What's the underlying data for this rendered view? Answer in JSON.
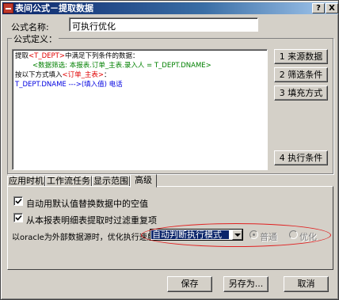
{
  "window": {
    "title": "表间公式－提取数据",
    "help_label": "?",
    "close_label": "X"
  },
  "formula_name": {
    "label": "公式名称:",
    "value": "可执行优化"
  },
  "definition": {
    "legend": "公式定义：",
    "lines": [
      {
        "pre": "提取",
        "kw": "<T_DEPT>",
        "post": "中满足下列条件的数据："
      },
      {
        "text": "<数据筛选: 本报表.订单_主表.录入人 = T_DEPT.DNAME>"
      },
      {
        "pre": "按以下方式填入",
        "kw": "<订单_主表>",
        "post": "："
      },
      {
        "pre": "T_DEPT.DNAME  --->",
        "kw": "(填入值)",
        "post": "  电话"
      }
    ]
  },
  "side_buttons": {
    "source_data": "1 来源数据",
    "filter_condition": "2 筛选条件",
    "fill_method": "3 填充方式",
    "exec_condition": "4 执行条件"
  },
  "tabs": [
    "应用时机",
    "工作流任务",
    "显示范围",
    "高级"
  ],
  "advanced": {
    "option1": "自动用默认值替换数据中的空值",
    "option2": "从本报表明细表提取时过滤重复项",
    "speed_label": "以oracle为外部数据源时，优化执行速度:",
    "mode_value": "自动判断执行模式",
    "radio_normal": "普通",
    "radio_optimize": "优化"
  },
  "footer": {
    "save": "保存",
    "save_as": "另存为...",
    "cancel": "取消"
  }
}
